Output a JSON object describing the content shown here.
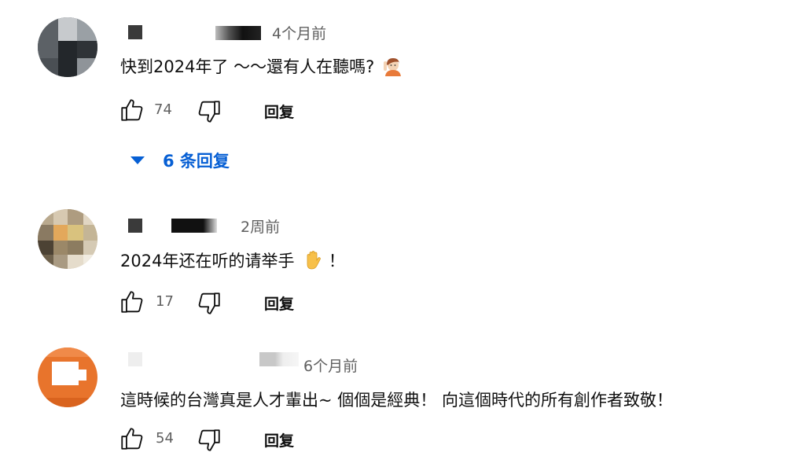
{
  "comments": [
    {
      "time": "4个月前",
      "text": "快到2024年了 ～～還有人在聽嗎?",
      "emoji": "person-raising-hand-emoji",
      "likes": "74",
      "reply_label": "回复",
      "replies_label": "6 条回复"
    },
    {
      "time": "2周前",
      "text": "2024年还在听的请举手",
      "text_suffix": "！",
      "emoji": "raised-hand-emoji",
      "likes": "17",
      "reply_label": "回复"
    },
    {
      "time": "6个月前",
      "text": "這時候的台灣真是人才輩出~ 個個是經典！ 向這個時代的所有創作者致敬！",
      "likes": "54",
      "reply_label": "回复"
    }
  ],
  "colors": {
    "link_blue": "#065fd4",
    "secondary_text": "#606060",
    "avatar3_orange": "#e8742c"
  }
}
